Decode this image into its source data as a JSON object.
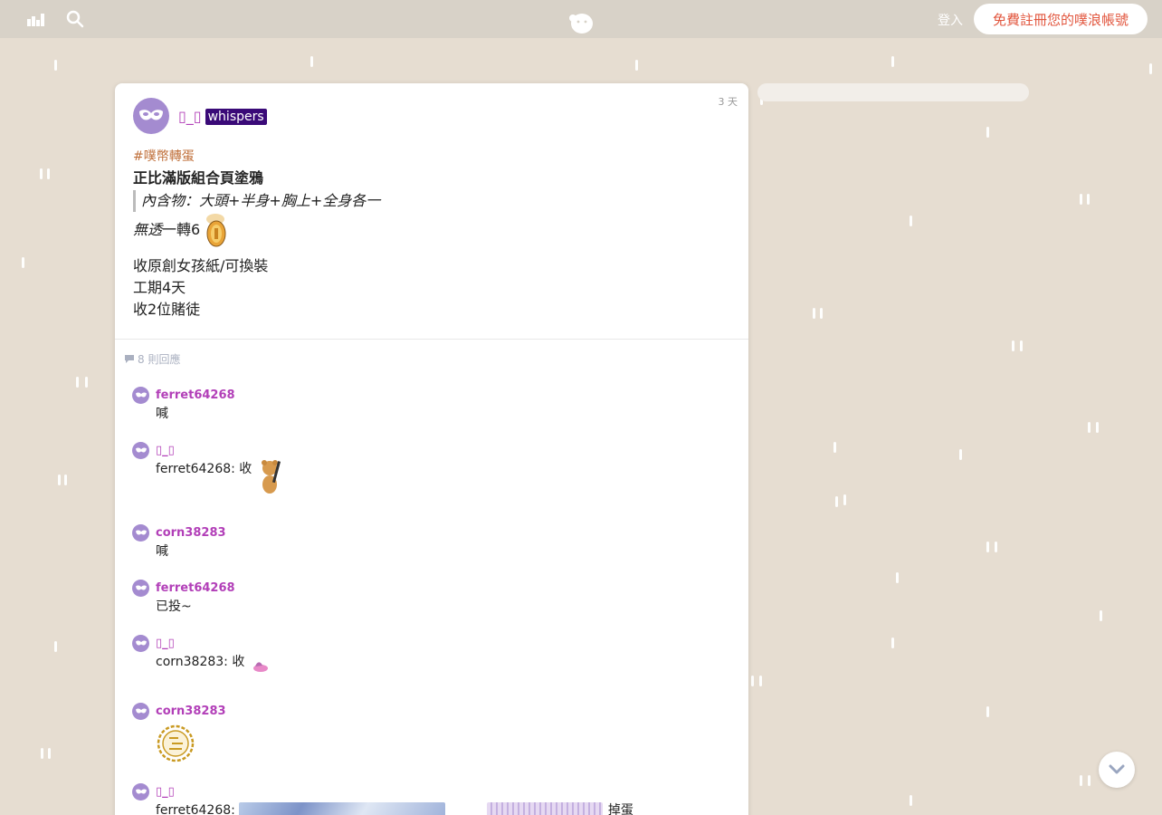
{
  "topbar": {
    "login_label": "登入",
    "signup_label": "免費註冊您的噗浪帳號",
    "icons": [
      "chart-icon",
      "search-icon",
      "plurk-logo-icon"
    ]
  },
  "post": {
    "time": "3 天",
    "author": "▯_▯",
    "tag": "whispers",
    "hashtag": "#噗幣轉蛋",
    "title": "正比滿版組合頁塗鴉",
    "quote": "內含物：大頭+半身+胸上+全身各一",
    "line_italic": "無透",
    "line_rest": " 一轉6",
    "lines": [
      "收原創女孩紙/可換裝",
      "工期4天",
      "收2位賭徒"
    ],
    "reply_count": "8 則回應"
  },
  "responses": [
    {
      "name": "ferret64268",
      "text": "喊"
    },
    {
      "name": "▯_▯",
      "text": "ferret64268: 收"
    },
    {
      "name": "corn38283",
      "text": "喊"
    },
    {
      "name": "ferret64268",
      "text": "已投~"
    },
    {
      "name": "▯_▯",
      "text": "corn38283: 收"
    },
    {
      "name": "corn38283",
      "text": ""
    },
    {
      "name": "▯_▯",
      "text": "ferret64268:",
      "extra": "掉蛋"
    }
  ],
  "colors": {
    "background": "#e6ddd1",
    "accent": "#e2563e",
    "author": "#b23fb8",
    "whisper_bg": "#3a0a78"
  }
}
